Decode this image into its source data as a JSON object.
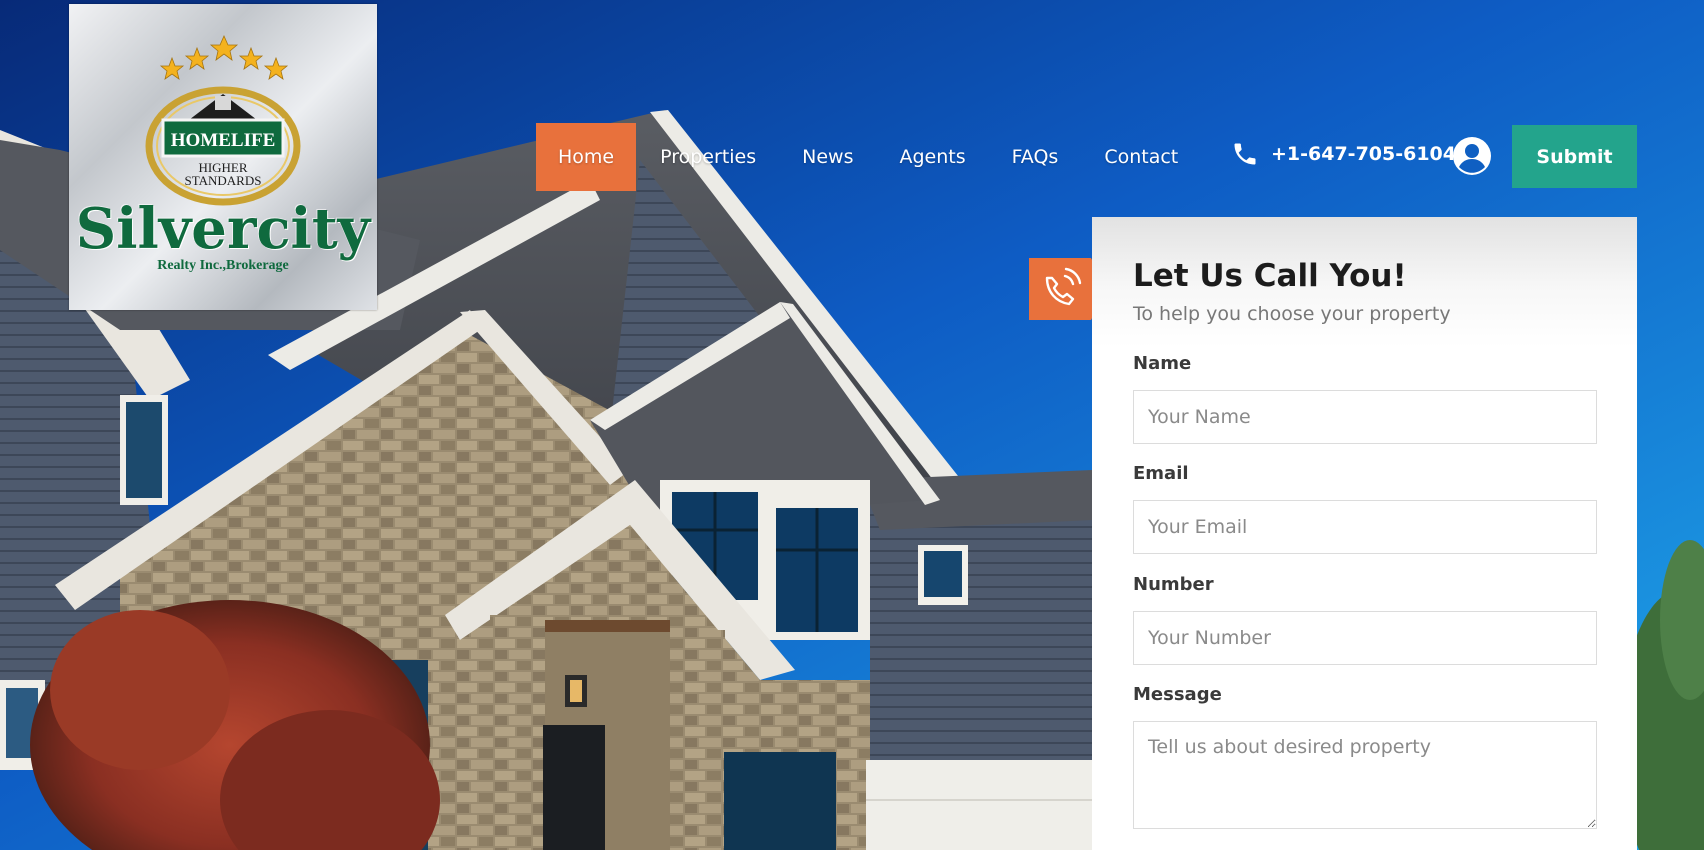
{
  "logo": {
    "brand": "HOMELIFE",
    "tagline_1": "HIGHER",
    "tagline_2": "STANDARDS",
    "name": "Silvercity",
    "subtitle": "Realty Inc.,Brokerage"
  },
  "nav": {
    "items": [
      {
        "label": "Home",
        "active": true
      },
      {
        "label": "Properties",
        "active": false
      },
      {
        "label": "News",
        "active": false
      },
      {
        "label": "Agents",
        "active": false
      },
      {
        "label": "FAQs",
        "active": false
      },
      {
        "label": "Contact",
        "active": false
      }
    ],
    "phone": "+1-647-705-6104",
    "submit_label": "Submit",
    "icons": [
      "phone-icon",
      "user-icon"
    ]
  },
  "form": {
    "title": "Let Us Call You!",
    "subtitle": "To help you choose your property",
    "fields": {
      "name": {
        "label": "Name",
        "placeholder": "Your Name",
        "value": ""
      },
      "email": {
        "label": "Email",
        "placeholder": "Your Email",
        "value": ""
      },
      "number": {
        "label": "Number",
        "placeholder": "Your Number",
        "value": ""
      },
      "message": {
        "label": "Message",
        "placeholder": "Tell us about desired property",
        "value": ""
      }
    },
    "icon": "phone-call-icon"
  },
  "colors": {
    "accent_orange": "#e8713c",
    "accent_teal": "#23a48c",
    "brand_green": "#0f6a3e"
  }
}
